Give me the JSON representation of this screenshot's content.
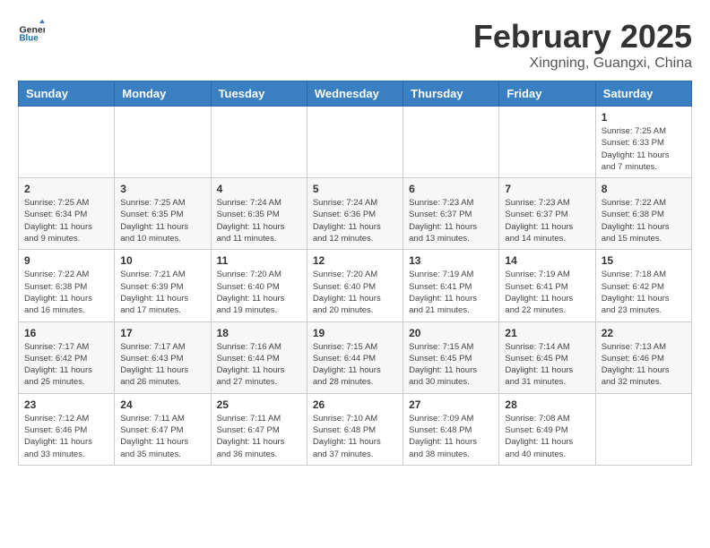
{
  "header": {
    "logo_line1": "General",
    "logo_line2": "Blue",
    "title": "February 2025",
    "subtitle": "Xingning, Guangxi, China"
  },
  "weekdays": [
    "Sunday",
    "Monday",
    "Tuesday",
    "Wednesday",
    "Thursday",
    "Friday",
    "Saturday"
  ],
  "weeks": [
    [
      {
        "day": "",
        "info": ""
      },
      {
        "day": "",
        "info": ""
      },
      {
        "day": "",
        "info": ""
      },
      {
        "day": "",
        "info": ""
      },
      {
        "day": "",
        "info": ""
      },
      {
        "day": "",
        "info": ""
      },
      {
        "day": "1",
        "info": "Sunrise: 7:25 AM\nSunset: 6:33 PM\nDaylight: 11 hours and 7 minutes."
      }
    ],
    [
      {
        "day": "2",
        "info": "Sunrise: 7:25 AM\nSunset: 6:34 PM\nDaylight: 11 hours and 9 minutes."
      },
      {
        "day": "3",
        "info": "Sunrise: 7:25 AM\nSunset: 6:35 PM\nDaylight: 11 hours and 10 minutes."
      },
      {
        "day": "4",
        "info": "Sunrise: 7:24 AM\nSunset: 6:35 PM\nDaylight: 11 hours and 11 minutes."
      },
      {
        "day": "5",
        "info": "Sunrise: 7:24 AM\nSunset: 6:36 PM\nDaylight: 11 hours and 12 minutes."
      },
      {
        "day": "6",
        "info": "Sunrise: 7:23 AM\nSunset: 6:37 PM\nDaylight: 11 hours and 13 minutes."
      },
      {
        "day": "7",
        "info": "Sunrise: 7:23 AM\nSunset: 6:37 PM\nDaylight: 11 hours and 14 minutes."
      },
      {
        "day": "8",
        "info": "Sunrise: 7:22 AM\nSunset: 6:38 PM\nDaylight: 11 hours and 15 minutes."
      }
    ],
    [
      {
        "day": "9",
        "info": "Sunrise: 7:22 AM\nSunset: 6:38 PM\nDaylight: 11 hours and 16 minutes."
      },
      {
        "day": "10",
        "info": "Sunrise: 7:21 AM\nSunset: 6:39 PM\nDaylight: 11 hours and 17 minutes."
      },
      {
        "day": "11",
        "info": "Sunrise: 7:20 AM\nSunset: 6:40 PM\nDaylight: 11 hours and 19 minutes."
      },
      {
        "day": "12",
        "info": "Sunrise: 7:20 AM\nSunset: 6:40 PM\nDaylight: 11 hours and 20 minutes."
      },
      {
        "day": "13",
        "info": "Sunrise: 7:19 AM\nSunset: 6:41 PM\nDaylight: 11 hours and 21 minutes."
      },
      {
        "day": "14",
        "info": "Sunrise: 7:19 AM\nSunset: 6:41 PM\nDaylight: 11 hours and 22 minutes."
      },
      {
        "day": "15",
        "info": "Sunrise: 7:18 AM\nSunset: 6:42 PM\nDaylight: 11 hours and 23 minutes."
      }
    ],
    [
      {
        "day": "16",
        "info": "Sunrise: 7:17 AM\nSunset: 6:42 PM\nDaylight: 11 hours and 25 minutes."
      },
      {
        "day": "17",
        "info": "Sunrise: 7:17 AM\nSunset: 6:43 PM\nDaylight: 11 hours and 26 minutes."
      },
      {
        "day": "18",
        "info": "Sunrise: 7:16 AM\nSunset: 6:44 PM\nDaylight: 11 hours and 27 minutes."
      },
      {
        "day": "19",
        "info": "Sunrise: 7:15 AM\nSunset: 6:44 PM\nDaylight: 11 hours and 28 minutes."
      },
      {
        "day": "20",
        "info": "Sunrise: 7:15 AM\nSunset: 6:45 PM\nDaylight: 11 hours and 30 minutes."
      },
      {
        "day": "21",
        "info": "Sunrise: 7:14 AM\nSunset: 6:45 PM\nDaylight: 11 hours and 31 minutes."
      },
      {
        "day": "22",
        "info": "Sunrise: 7:13 AM\nSunset: 6:46 PM\nDaylight: 11 hours and 32 minutes."
      }
    ],
    [
      {
        "day": "23",
        "info": "Sunrise: 7:12 AM\nSunset: 6:46 PM\nDaylight: 11 hours and 33 minutes."
      },
      {
        "day": "24",
        "info": "Sunrise: 7:11 AM\nSunset: 6:47 PM\nDaylight: 11 hours and 35 minutes."
      },
      {
        "day": "25",
        "info": "Sunrise: 7:11 AM\nSunset: 6:47 PM\nDaylight: 11 hours and 36 minutes."
      },
      {
        "day": "26",
        "info": "Sunrise: 7:10 AM\nSunset: 6:48 PM\nDaylight: 11 hours and 37 minutes."
      },
      {
        "day": "27",
        "info": "Sunrise: 7:09 AM\nSunset: 6:48 PM\nDaylight: 11 hours and 38 minutes."
      },
      {
        "day": "28",
        "info": "Sunrise: 7:08 AM\nSunset: 6:49 PM\nDaylight: 11 hours and 40 minutes."
      },
      {
        "day": "",
        "info": ""
      }
    ]
  ]
}
